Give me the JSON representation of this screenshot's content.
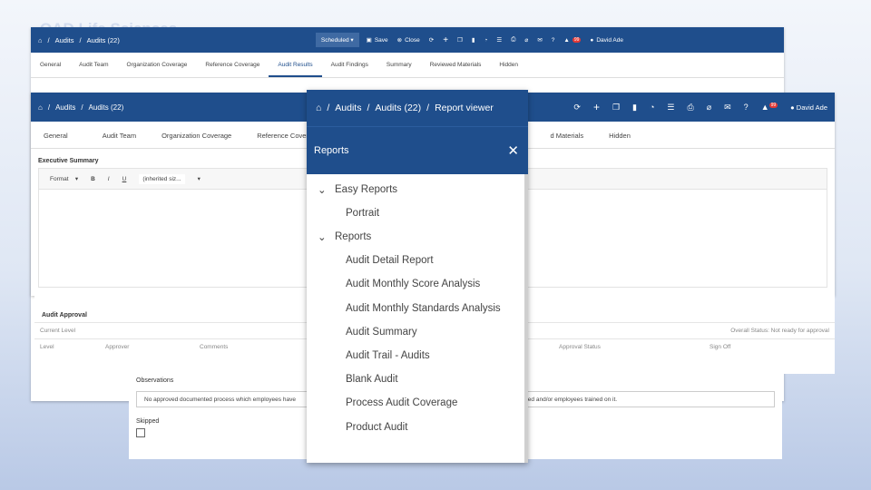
{
  "slide_title": "QAD Life Sciences",
  "win1": {
    "breadcrumbs": [
      "Audits",
      "Audits (22)"
    ],
    "status": "Scheduled",
    "actions": [
      "Save",
      "Close"
    ],
    "badge": "99",
    "user": "David Ade",
    "tabs": [
      "General",
      "Audit Team",
      "Organization Coverage",
      "Reference Coverage",
      "Audit Results",
      "Audit Findings",
      "Summary",
      "Reviewed Materials",
      "Hidden"
    ],
    "active_tab": "Audit Results"
  },
  "win2": {
    "breadcrumbs": [
      "Audits",
      "Audits (22)"
    ],
    "badge": "99",
    "user": "David Ade",
    "tabs": [
      "General",
      "Audit Team",
      "Organization Coverage",
      "Reference Coverage",
      "d Materials",
      "Hidden"
    ],
    "section": "Executive Summary",
    "editor_toolbar": {
      "format": "Format",
      "bold": "B",
      "italic": "I",
      "underline": "U",
      "size_placeholder": "(inherited siz..."
    }
  },
  "approval": {
    "title": "Audit Approval",
    "current_level": "Current Level",
    "overall_status": "Overall Status: Not ready for approval",
    "columns": [
      "Level",
      "Approver",
      "Comments",
      "Approval Status",
      "Sign Off"
    ]
  },
  "observations": {
    "title": "Observations",
    "text": "No approved documented process which employees have",
    "text_tail": "approved and/or employees trained on it.",
    "skipped_label": "Skipped"
  },
  "panel": {
    "breadcrumbs": [
      "Audits",
      "Audits (22)",
      "Report viewer"
    ],
    "header": "Reports",
    "groups": [
      {
        "label": "Easy Reports",
        "items": [
          "Portrait"
        ]
      },
      {
        "label": "Reports",
        "items": [
          "Audit Detail Report",
          "Audit Monthly Score Analysis",
          "Audit Monthly Standards Analysis",
          "Audit Summary",
          "Audit Trail - Audits",
          "Blank Audit",
          "Process Audit Coverage",
          "Product Audit"
        ]
      }
    ]
  },
  "colors": {
    "topbar": "#1f4e8c",
    "accent": "#1f4e8c",
    "badge": "#e53935"
  }
}
